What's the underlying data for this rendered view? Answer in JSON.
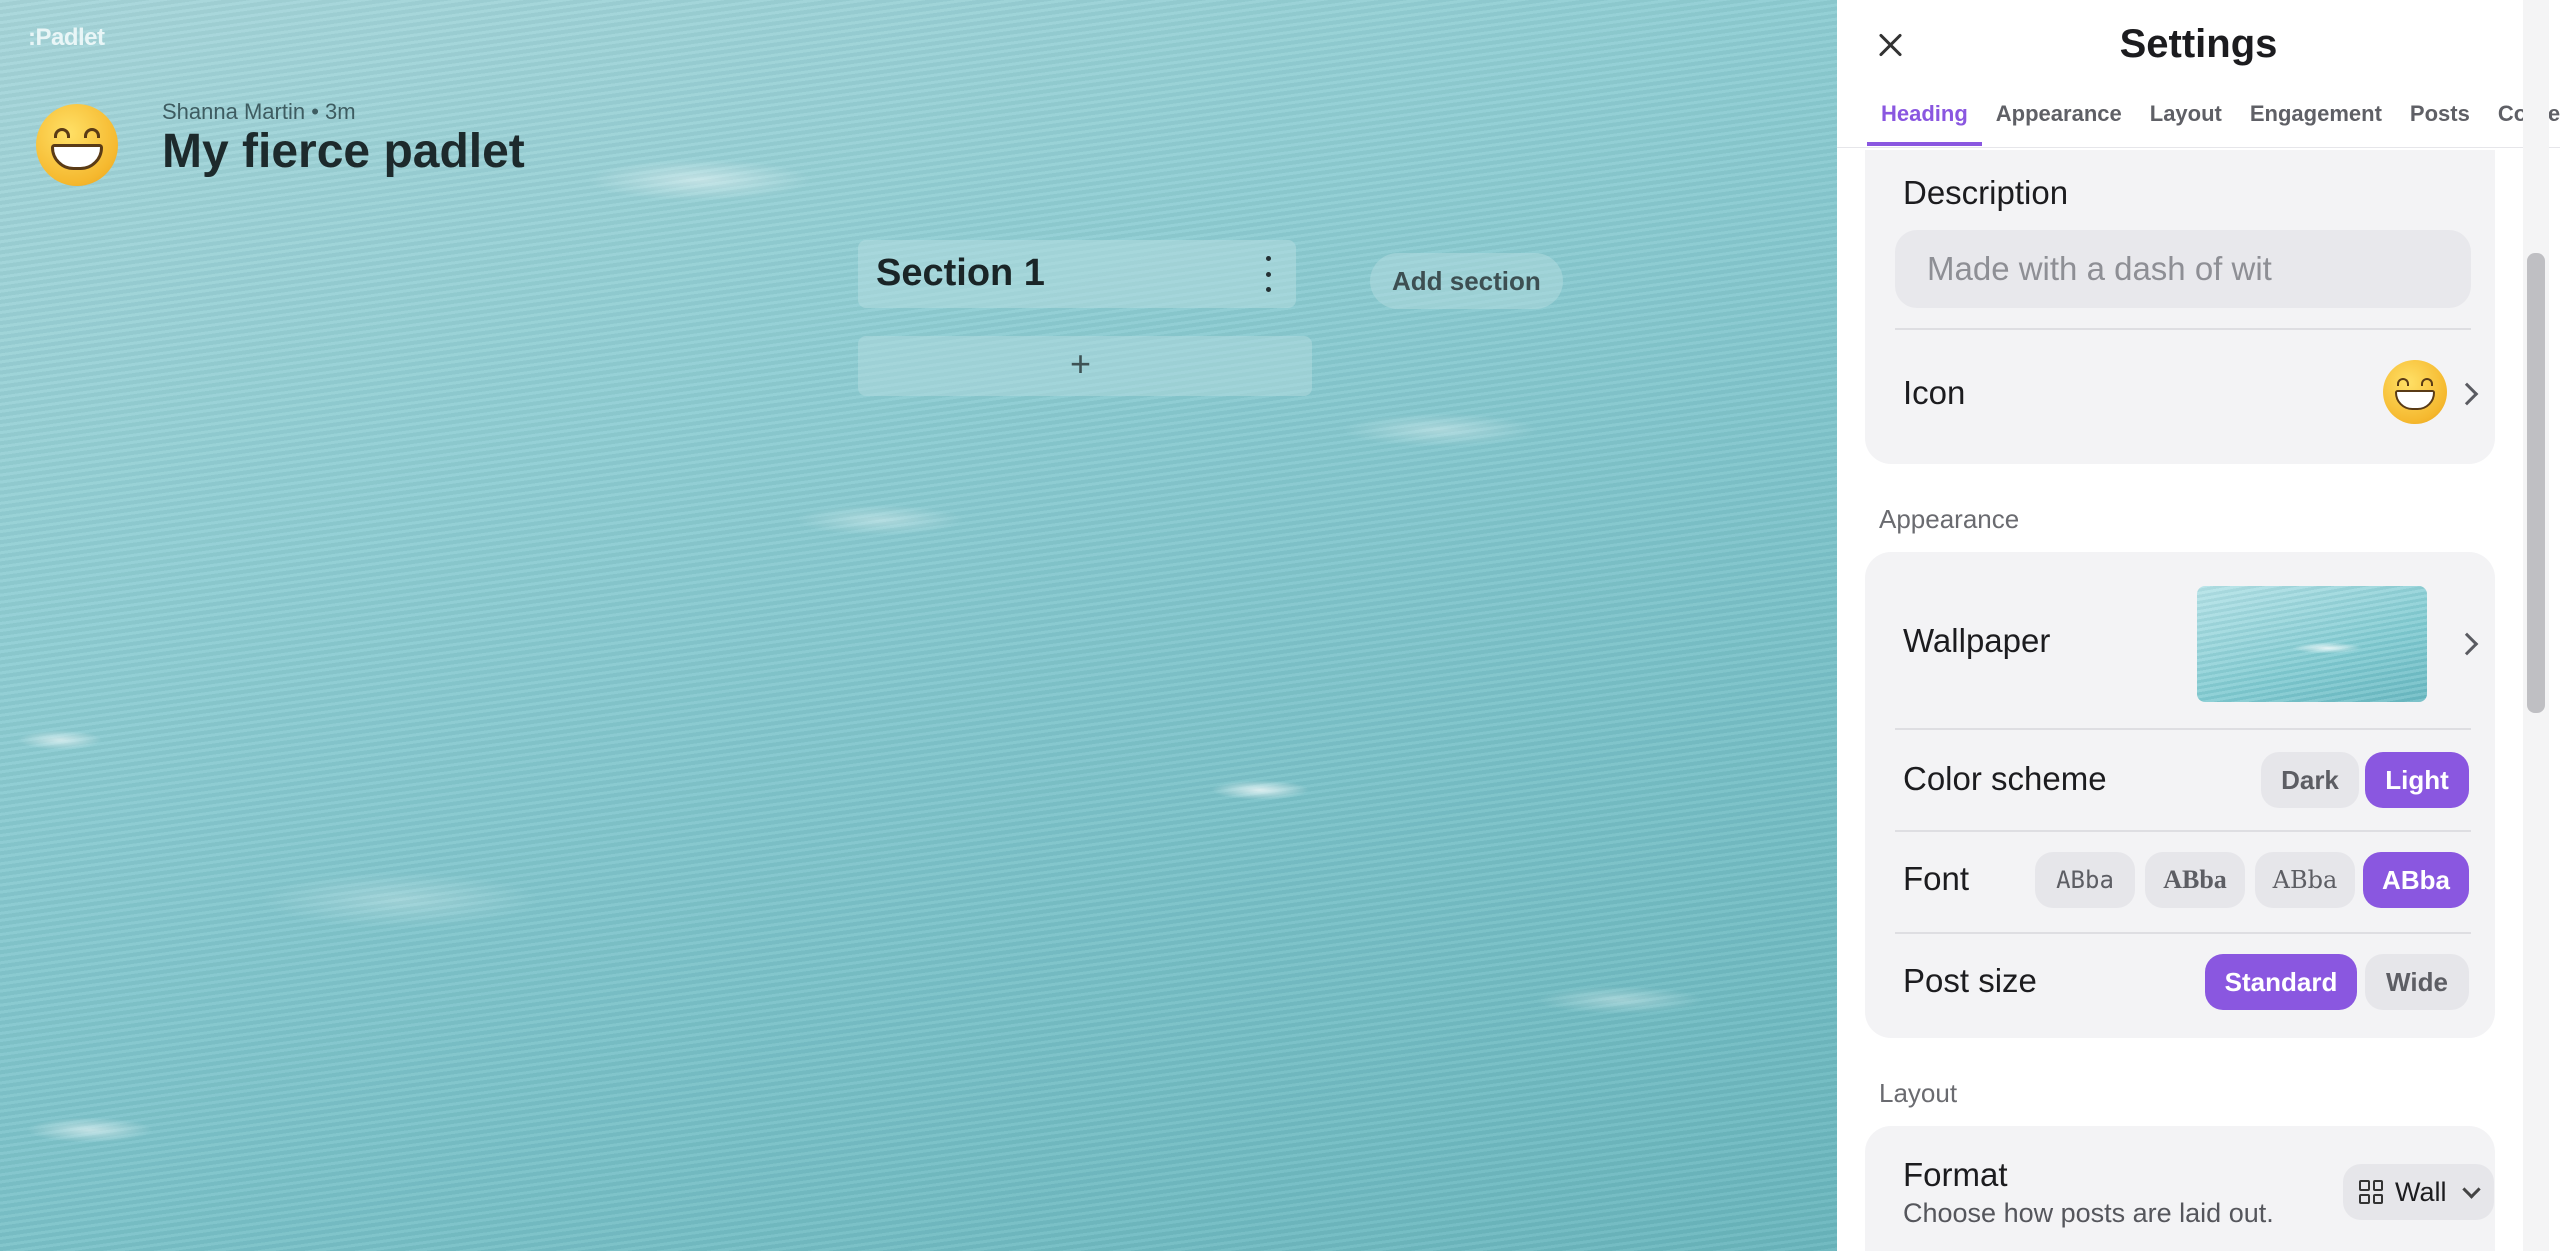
{
  "board": {
    "logo": ":Padlet",
    "author_meta": "Shanna Martin • 3m",
    "title": "My fierce padlet",
    "section_name": "Section 1",
    "add_post_symbol": "+",
    "add_section_label": "Add section"
  },
  "settings": {
    "title": "Settings",
    "tabs": [
      "Heading",
      "Appearance",
      "Layout",
      "Engagement",
      "Posts",
      "Conte"
    ],
    "active_tab": "Heading",
    "heading": {
      "description_label": "Description",
      "description_placeholder": "Made with a dash of wit",
      "icon_label": "Icon",
      "icon_name": "grinning-face-emoji"
    },
    "appearance": {
      "group_label": "Appearance",
      "wallpaper_label": "Wallpaper",
      "color_scheme_label": "Color scheme",
      "color_scheme_options": [
        "Dark",
        "Light"
      ],
      "color_scheme_selected": "Light",
      "font_label": "Font",
      "font_options": [
        "ABba",
        "ABba",
        "ABba",
        "ABba"
      ],
      "font_selected_index": 3,
      "post_size_label": "Post size",
      "post_size_options": [
        "Standard",
        "Wide"
      ],
      "post_size_selected": "Standard"
    },
    "layout": {
      "group_label": "Layout",
      "format_label": "Format",
      "format_description": "Choose how posts are laid out.",
      "format_value": "Wall"
    }
  },
  "colors": {
    "accent": "#8a57e0",
    "panel_bg": "#ffffff",
    "card_bg": "#f3f3f5"
  }
}
